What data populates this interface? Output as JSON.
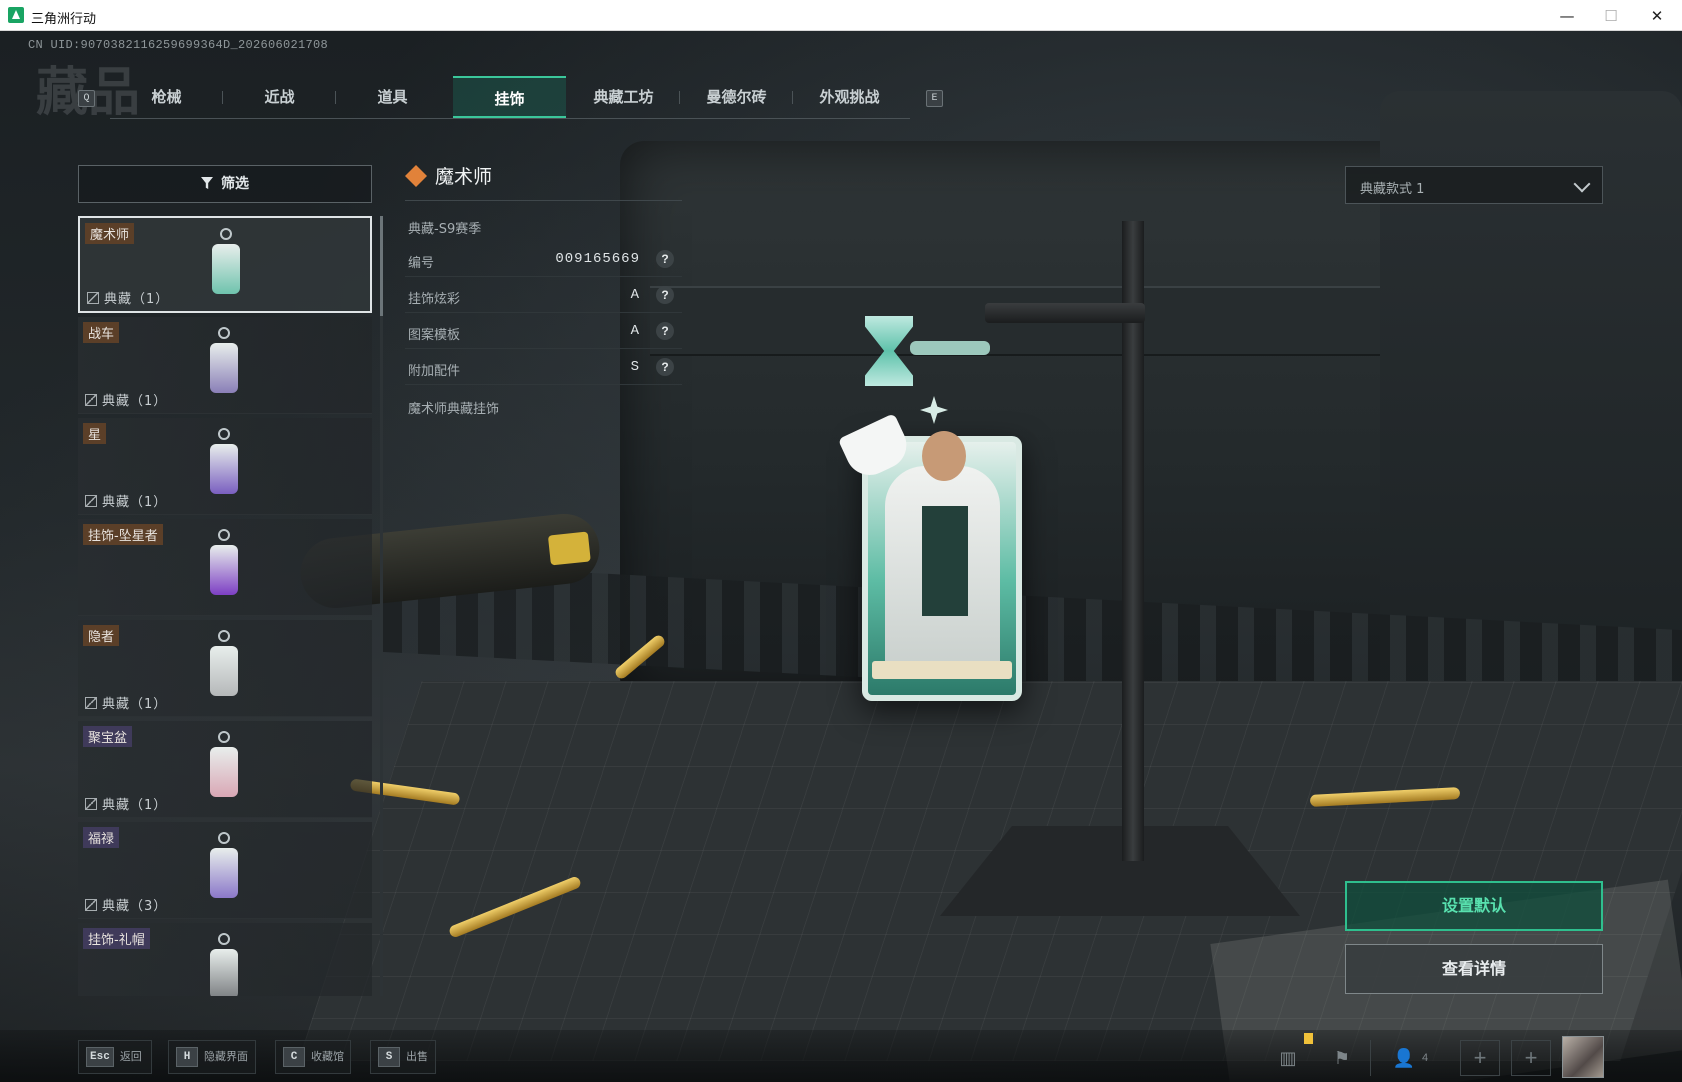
{
  "window": {
    "title": "三角洲行动"
  },
  "uid": "CN UID:9070382116259699364D_202606021708",
  "page_heading": "藏品",
  "tabs": {
    "prev_key": "Q",
    "next_key": "E",
    "items": [
      {
        "label": "枪械"
      },
      {
        "label": "近战"
      },
      {
        "label": "道具"
      },
      {
        "label": "挂饰",
        "active": true
      },
      {
        "label": "典藏工坊"
      },
      {
        "label": "曼德尔砖"
      },
      {
        "label": "外观挑战"
      }
    ]
  },
  "filter": {
    "label": "筛选"
  },
  "list": {
    "items": [
      {
        "tag": "魔术师",
        "stat": "典藏（1）",
        "selected": true,
        "thumb_color": "#6fc3ad"
      },
      {
        "tag": "战车",
        "stat": "典藏（1）",
        "thumb_color": "#8a7fb7"
      },
      {
        "tag": "星",
        "stat": "典藏（1）",
        "thumb_color": "#7a5fc0"
      },
      {
        "tag": "挂饰-坠星者",
        "stat": "",
        "thumb_color": "#7d3fc4"
      },
      {
        "tag": "隐者",
        "stat": "典藏（1）",
        "thumb_color": "#b5b8b9"
      },
      {
        "tag": "聚宝盆",
        "stat": "典藏（1）",
        "thumb_color": "#d9a7b5",
        "purple": true
      },
      {
        "tag": "福禄",
        "stat": "典藏（3）",
        "thumb_color": "#8b78c9",
        "purple": true
      },
      {
        "tag": "挂饰-礼帽",
        "stat": "",
        "thumb_color": "#7a7d80",
        "purple": true
      }
    ]
  },
  "detail": {
    "title": "魔术师",
    "season": "典藏-S9赛季",
    "props": [
      {
        "key": "编号",
        "value": "009165669"
      },
      {
        "key": "挂饰炫彩",
        "value": "A"
      },
      {
        "key": "图案模板",
        "value": "A"
      },
      {
        "key": "附加配件",
        "value": "S"
      }
    ],
    "help_glyph": "?",
    "description": "魔术师典藏挂饰"
  },
  "style_select": {
    "value": "典藏款式 1"
  },
  "actions": {
    "set_default": "设置默认",
    "view_detail": "查看详情"
  },
  "hotkeys": [
    {
      "key": "Esc",
      "label": "返回"
    },
    {
      "key": "H",
      "label": "隐藏界面"
    },
    {
      "key": "C",
      "label": "收藏馆"
    },
    {
      "key": "S",
      "label": "出售"
    }
  ],
  "status": {
    "party_count": "4"
  },
  "colors": {
    "accent": "#3bc79b",
    "accent_text": "#58e0ae",
    "title_icon": "#e1823a"
  }
}
